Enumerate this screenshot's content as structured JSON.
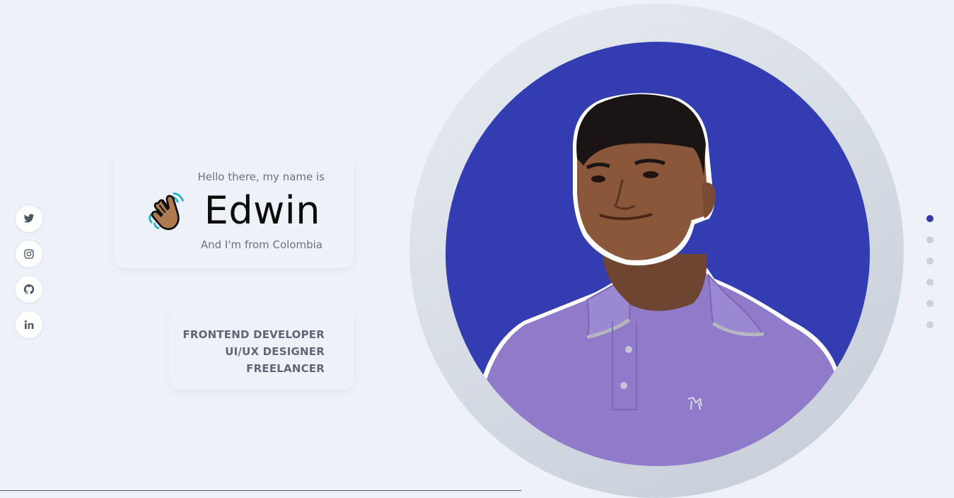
{
  "intro": {
    "greeting": "Hello there, my name is",
    "name": "Edwin",
    "origin": "And I'm from Colombia"
  },
  "roles": [
    "FRONTEND DEVELOPER",
    "UI/UX DESIGNER",
    "FREELANCER"
  ],
  "social": [
    {
      "icon": "twitter-icon"
    },
    {
      "icon": "instagram-icon"
    },
    {
      "icon": "github-icon"
    },
    {
      "icon": "linkedin-icon"
    }
  ],
  "pagination": {
    "count": 6,
    "active_index": 0
  },
  "colors": {
    "background": "#eef2f8",
    "photo_background": "#333cb0",
    "accent": "#3437a6",
    "shirt": "#8f7bc9"
  }
}
